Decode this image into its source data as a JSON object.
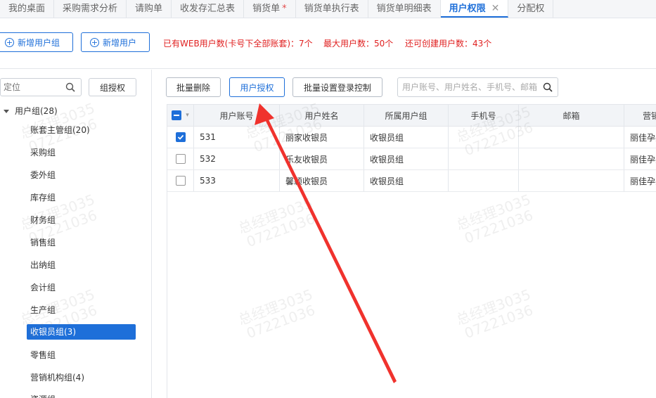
{
  "tabs": [
    {
      "label": "我的桌面"
    },
    {
      "label": "采购需求分析"
    },
    {
      "label": "请购单"
    },
    {
      "label": "收发存汇总表"
    },
    {
      "label": "销货单",
      "modified": "*"
    },
    {
      "label": "销货单执行表"
    },
    {
      "label": "销货单明细表"
    },
    {
      "label": "用户权限",
      "active": true,
      "close": "✕"
    },
    {
      "label": "分配权"
    }
  ],
  "toolbar": {
    "add_group_label": "新增用户组",
    "add_user_label": "新增用户",
    "info": [
      "已有WEB用户数(卡号下全部账套)：7个",
      "最大用户数：50个",
      "还可创建用户数：43个"
    ]
  },
  "left_panel": {
    "search_placeholder": "定位",
    "group_auth_label": "组授权",
    "tree_root": "用户组(28)",
    "tree_items": [
      {
        "label": "账套主管组(20)"
      },
      {
        "label": "采购组"
      },
      {
        "label": "委外组"
      },
      {
        "label": "库存组"
      },
      {
        "label": "财务组"
      },
      {
        "label": "销售组"
      },
      {
        "label": "出纳组"
      },
      {
        "label": "会计组"
      },
      {
        "label": "生产组"
      },
      {
        "label": "收银员组(3)",
        "selected": true
      },
      {
        "label": "零售组"
      },
      {
        "label": "营销机构组(4)"
      },
      {
        "label": "资源组"
      }
    ]
  },
  "actions": {
    "batch_delete": "批量删除",
    "user_auth": "用户授权",
    "batch_login": "批量设置登录控制",
    "search_placeholder": "用户账号、用户姓名、手机号、邮箱"
  },
  "grid": {
    "columns": [
      "用户账号",
      "用户姓名",
      "所属用户组",
      "手机号",
      "邮箱",
      "营销"
    ],
    "rows": [
      {
        "checked": true,
        "account": "531",
        "name": "丽家收银员",
        "group": "收银员组",
        "phone": "",
        "email": "",
        "org": "丽佳孕婴"
      },
      {
        "checked": false,
        "account": "532",
        "name": "乐友收银员",
        "group": "收银员组",
        "phone": "",
        "email": "",
        "org": "丽佳孕婴"
      },
      {
        "checked": false,
        "account": "533",
        "name": "馨颖收银员",
        "group": "收银员组",
        "phone": "",
        "email": "",
        "org": "丽佳孕婴"
      }
    ]
  },
  "watermark": {
    "line1": "总经理3035",
    "line2": "07221036"
  },
  "colors": {
    "accent": "#1e6fd9",
    "warning": "#e02020",
    "arrow": "#f0322d"
  }
}
